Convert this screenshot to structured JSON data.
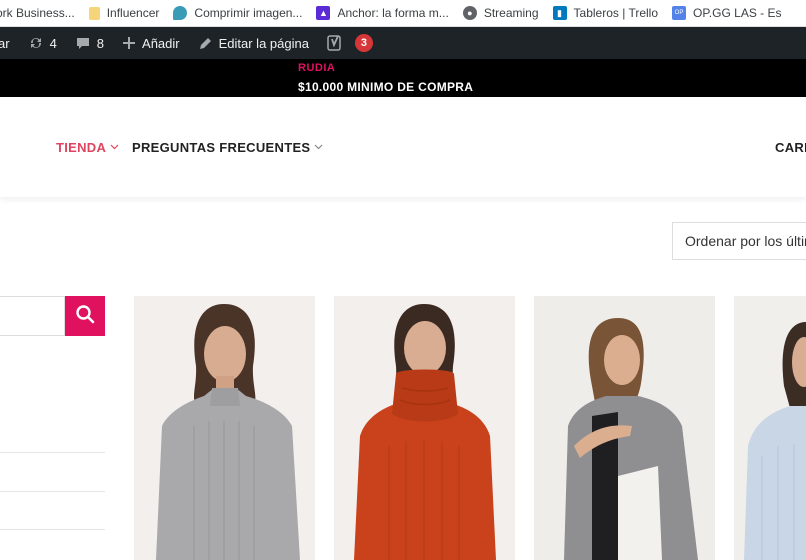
{
  "bookmarks": [
    {
      "label": "ork Business...",
      "icon": "upwork-icon"
    },
    {
      "label": "Influencer",
      "icon": "folder-icon"
    },
    {
      "label": "Comprimir imagen...",
      "icon": "bird-icon"
    },
    {
      "label": "Anchor: la forma m...",
      "icon": "anchor-icon"
    },
    {
      "label": "Streaming",
      "icon": "globe-icon"
    },
    {
      "label": "Tableros | Trello",
      "icon": "trello-icon"
    },
    {
      "label": "OP.GG LAS - Es",
      "icon": "opgg-icon"
    }
  ],
  "adminbar": {
    "first_label": "ar",
    "updates_count": "4",
    "comments_count": "8",
    "new_label": "Añadir",
    "edit_label": "Editar la página",
    "yoast_badge": "3"
  },
  "promo": {
    "brand": "RUDIA",
    "text": "$10.000 MINIMO DE COMPRA"
  },
  "nav": {
    "shop": "TIENDA",
    "faq": "PREGUNTAS FRECUENTES",
    "cart": "CARR"
  },
  "sort": {
    "label": "Ordenar por los últimos"
  },
  "products": [
    {
      "name": "grey-cable-knit-sweater",
      "color": "#a9a9ab"
    },
    {
      "name": "rust-turtleneck-sweater",
      "color": "#c9421c"
    },
    {
      "name": "colorblock-sweater",
      "color": "#8f8f92"
    },
    {
      "name": "light-blue-sweater",
      "color": "#c9d6e6"
    }
  ],
  "colors": {
    "accent": "#e0115f",
    "admin_bg": "#1d2327",
    "nav_active": "#e0455f"
  }
}
